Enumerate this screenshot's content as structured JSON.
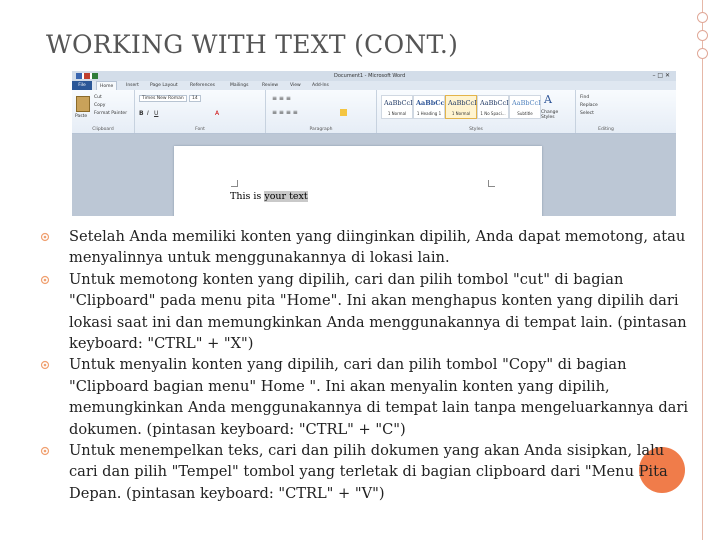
{
  "slide": {
    "title": "WORKING WITH TEXT (CONT.)",
    "accent_color": "#f07c4a",
    "bullet_color": "#f0a070"
  },
  "word_screenshot": {
    "window_title": "Document1 - Microsoft Word",
    "tabs": [
      "File",
      "Home",
      "Insert",
      "Page Layout",
      "References",
      "Mailings",
      "Review",
      "View",
      "Add-Ins"
    ],
    "active_tab": "Home",
    "clipboard": {
      "paste": "Paste",
      "cut": "Cut",
      "copy": "Copy",
      "format_painter": "Format Painter",
      "group_label": "Clipboard"
    },
    "font": {
      "name": "Times New Roman",
      "size": "14",
      "group_label": "Font"
    },
    "paragraph_group_label": "Paragraph",
    "styles": [
      {
        "sample": "AaBbCcI",
        "name": "1 Normal"
      },
      {
        "sample": "AaBbCc",
        "name": "1 Heading 1"
      },
      {
        "sample": "AaBbCcI",
        "name": "1 Normal"
      },
      {
        "sample": "AaBbCcI",
        "name": "1 No Spaci..."
      },
      {
        "sample": "AaBbCcI",
        "name": "Subtitle"
      }
    ],
    "change_styles": "Change Styles",
    "styles_group_label": "Styles",
    "editing": {
      "find": "Find",
      "replace": "Replace",
      "select": "Select",
      "group_label": "Editing"
    },
    "document_text_plain": "This is ",
    "document_text_selected": "your text"
  },
  "bullets": [
    {
      "text": "Setelah Anda memiliki konten yang diinginkan dipilih, Anda dapat memotong, atau menyalinnya untuk menggunakannya di lokasi lain."
    },
    {
      "text": "Untuk memotong konten yang dipilih, cari dan pilih tombol \"cut\" di bagian \"Clipboard\" pada menu pita \"Home\". Ini akan menghapus konten yang dipilih dari lokasi saat ini dan memungkinkan Anda menggunakannya di tempat lain. (pintasan keyboard: \"CTRL\" + \"X\")"
    },
    {
      "text": "Untuk menyalin konten yang dipilih, cari dan pilih tombol \"Copy\" di bagian \"Clipboard bagian menu\" Home \". Ini akan menyalin konten yang dipilih, memungkinkan Anda menggunakannya di tempat lain tanpa mengeluarkannya dari dokumen. (pintasan keyboard: \"CTRL\" + \"C\")"
    },
    {
      "text": "Untuk menempelkan teks, cari dan pilih dokumen yang akan Anda sisipkan, lalu cari dan pilih \"Tempel\" tombol yang terletak di bagian clipboard dari \"Menu Pita Depan. (pintasan keyboard: \"CTRL\" + \"V\")"
    }
  ]
}
